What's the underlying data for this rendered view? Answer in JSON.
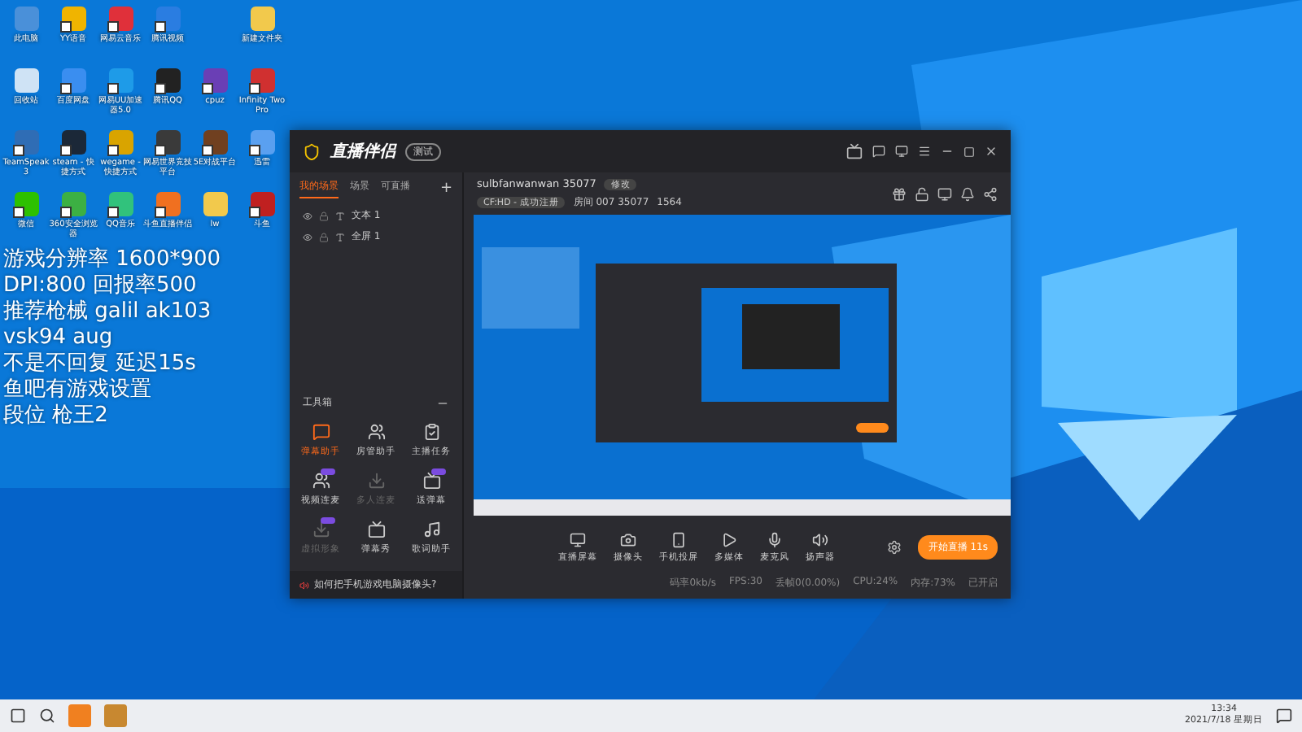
{
  "desktop_icons": [
    {
      "label": "此电脑",
      "color": "#4a90d9",
      "kind": "system"
    },
    {
      "label": "YY语音",
      "color": "#f0b400",
      "kind": "shortcut"
    },
    {
      "label": "网易云音乐",
      "color": "#e0303a",
      "kind": "shortcut"
    },
    {
      "label": "腾讯视频",
      "color": "#2a7de1",
      "kind": "shortcut"
    },
    {
      "kind": "blank"
    },
    {
      "label": "新建文件夹",
      "color": "#f2c94c",
      "kind": "folder"
    },
    {
      "label": "回收站",
      "color": "#cfe3f5",
      "kind": "system"
    },
    {
      "label": "百度网盘",
      "color": "#3a8ef0",
      "kind": "shortcut"
    },
    {
      "label": "网易UU加速器5.0",
      "color": "#1e9be8",
      "kind": "shortcut"
    },
    {
      "label": "腾讯QQ",
      "color": "#222222",
      "kind": "shortcut"
    },
    {
      "label": "cpuz",
      "color": "#6a3fb5",
      "kind": "shortcut"
    },
    {
      "label": "Infinity Two Pro",
      "color": "#d03030",
      "kind": "shortcut"
    },
    {
      "label": "TeamSpeak 3",
      "color": "#2f6db5",
      "kind": "shortcut"
    },
    {
      "label": "steam - 快捷方式",
      "color": "#1b2838",
      "kind": "shortcut"
    },
    {
      "label": "wegame - 快捷方式",
      "color": "#d9a400",
      "kind": "shortcut"
    },
    {
      "label": "网易世界竞技平台",
      "color": "#3a3a3a",
      "kind": "shortcut"
    },
    {
      "label": "5E对战平台",
      "color": "#704020",
      "kind": "shortcut"
    },
    {
      "label": "迅雷",
      "color": "#5aa0f0",
      "kind": "shortcut"
    },
    {
      "label": "微信",
      "color": "#2dc100",
      "kind": "shortcut"
    },
    {
      "label": "360安全浏览器",
      "color": "#3cb043",
      "kind": "shortcut"
    },
    {
      "label": "QQ音乐",
      "color": "#31c27c",
      "kind": "shortcut"
    },
    {
      "label": "斗鱼直播伴侣",
      "color": "#f07020",
      "kind": "shortcut"
    },
    {
      "label": "lw",
      "color": "#f2c94c",
      "kind": "folder"
    },
    {
      "label": "斗鱼",
      "color": "#c02020",
      "kind": "shortcut"
    }
  ],
  "overlay_text": [
    "游戏分辨率 1600*900",
    "DPI:800 回报率500",
    "推荐枪械 galil ak103",
    "vsk94 aug",
    "不是不回复 延迟15s",
    "鱼吧有游戏设置",
    "段位 枪王2"
  ],
  "app": {
    "title": "直播伴侣",
    "badge": "测试",
    "scene_tabs": [
      {
        "label": "我的场景",
        "selected": true
      },
      {
        "label": "场景",
        "selected": false
      },
      {
        "label": "可直播",
        "selected": false
      }
    ],
    "add": "+",
    "sources": [
      "文本 1",
      "全屏 1"
    ],
    "room": {
      "name": "sulbfanwanwan 35077",
      "edit": "修改",
      "category": "CF:HD - 成功注册",
      "room_no": "房间 007 35077",
      "heat": "1564"
    },
    "toolbox": {
      "title": "工具箱",
      "items": [
        {
          "label": "弹幕助手",
          "selected": true,
          "disabled": false,
          "badge": false
        },
        {
          "label": "房管助手",
          "selected": false,
          "disabled": false,
          "badge": false
        },
        {
          "label": "主播任务",
          "selected": false,
          "disabled": false,
          "badge": false
        },
        {
          "label": "视频连麦",
          "selected": false,
          "disabled": false,
          "badge": true
        },
        {
          "label": "多人连麦",
          "selected": false,
          "disabled": true,
          "badge": false
        },
        {
          "label": "送弹幕",
          "selected": false,
          "disabled": false,
          "badge": true
        },
        {
          "label": "虚拟形象",
          "selected": false,
          "disabled": true,
          "badge": true
        },
        {
          "label": "弹幕秀",
          "selected": false,
          "disabled": false,
          "badge": false
        },
        {
          "label": "歌词助手",
          "selected": false,
          "disabled": false,
          "badge": false
        }
      ]
    },
    "notice": "如何把手机游戏电脑摄像头?",
    "controls": [
      "直播屏幕",
      "摄像头",
      "手机投屏",
      "多媒体",
      "麦克风",
      "扬声器"
    ],
    "start": "开始直播 11s",
    "status": [
      "码率0kb/s",
      "FPS:30",
      "丢帧0(0.00%)",
      "CPU:24%",
      "内存:73%",
      "已开启"
    ]
  },
  "taskbar": {
    "time": "13:34",
    "date": "2021/7/18 星期日"
  }
}
